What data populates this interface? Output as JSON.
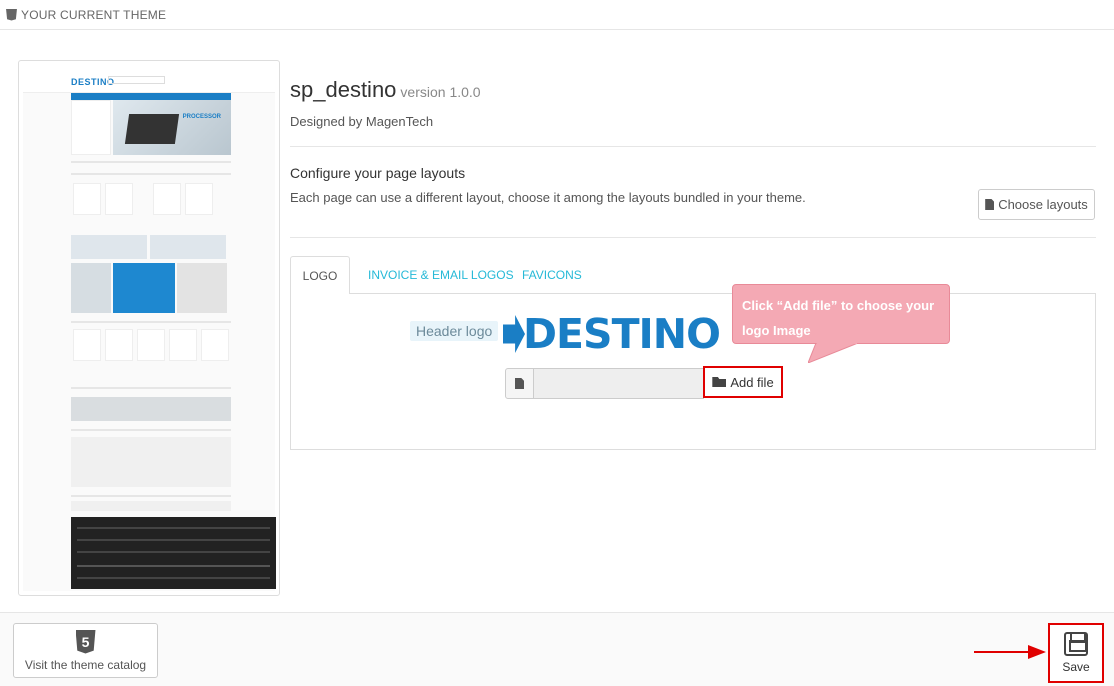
{
  "header": {
    "title": "YOUR CURRENT THEME"
  },
  "theme": {
    "name": "sp_destino",
    "version": "version 1.0.0",
    "designed_by": "Designed by MagenTech",
    "thumbnail_logo_text": "DESTINO"
  },
  "layouts": {
    "title": "Configure your page layouts",
    "description": "Each page can use a different layout, choose it among the layouts bundled in your theme.",
    "choose_button_label": "Choose layouts"
  },
  "tabs": [
    {
      "label": "LOGO",
      "active": true
    },
    {
      "label": "INVOICE & EMAIL LOGOS",
      "active": false
    },
    {
      "label": "FAVICONS",
      "active": false
    }
  ],
  "logo_panel": {
    "header_logo_label": "Header logo",
    "logo_text": "DESTINO",
    "add_file_label": "Add file",
    "file_value": "",
    "callout_text": "Click “Add file” to choose your logo Image"
  },
  "footer": {
    "catalog_button_label": "Visit the theme catalog",
    "save_button_label": "Save"
  },
  "colors": {
    "brand_blue": "#1a7ec5",
    "tab_link": "#25b9d7",
    "highlight_red": "#e00000",
    "callout_pink": "#f4a9b4"
  }
}
